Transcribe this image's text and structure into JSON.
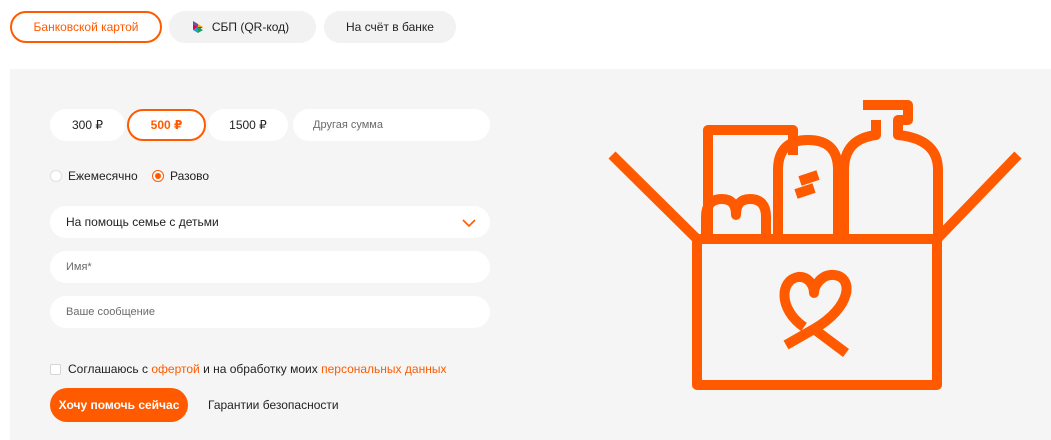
{
  "payment_tabs": [
    {
      "label": "Банковской картой",
      "active": true
    },
    {
      "label": "СБП (QR-код)",
      "active": false,
      "icon": "sbp-logo-icon"
    },
    {
      "label": "На счёт в банке",
      "active": false
    }
  ],
  "amounts": [
    {
      "label": "300 ₽",
      "active": false
    },
    {
      "label": "500 ₽",
      "active": true
    },
    {
      "label": "1500 ₽",
      "active": false
    }
  ],
  "custom_amount": {
    "placeholder": "Другая сумма",
    "value": ""
  },
  "frequency": {
    "options": [
      {
        "label": "Ежемесячно",
        "checked": false
      },
      {
        "label": "Разово",
        "checked": true
      }
    ]
  },
  "purpose_select": {
    "value": "На помощь семье с детьми",
    "icon": "chevron-down-icon"
  },
  "name_field": {
    "placeholder": "Имя*",
    "value": ""
  },
  "message_field": {
    "placeholder": "Ваше сообщение",
    "value": ""
  },
  "consent": {
    "prefix": "Соглашаюсь с ",
    "offer_link": "офертой",
    "middle": " и на обработку моих ",
    "data_link": "персональных данных",
    "checked": false
  },
  "submit_button": {
    "label": "Хочу помочь сейчас"
  },
  "security_link": {
    "label": "Гарантии безопасности"
  },
  "illustration": {
    "icon": "grocery-box-heart-icon"
  },
  "colors": {
    "accent": "#ff5a00",
    "panel": "#f5f5f5",
    "pill": "#f2f2f2"
  }
}
